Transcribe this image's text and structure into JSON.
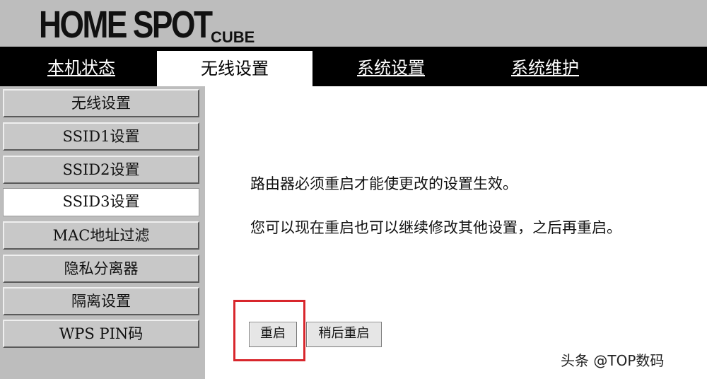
{
  "header": {
    "logo": "HOME SPOT",
    "logo_sub": "CUBE"
  },
  "nav": {
    "tabs": [
      {
        "label": "本机状态"
      },
      {
        "label": "无线设置"
      },
      {
        "label": "系统设置"
      },
      {
        "label": "系统维护"
      }
    ],
    "active_index": 1
  },
  "sidebar": {
    "items": [
      {
        "label": "无线设置"
      },
      {
        "label": "SSID1设置"
      },
      {
        "label": "SSID2设置"
      },
      {
        "label": "SSID3设置"
      },
      {
        "label": "MAC地址过滤"
      },
      {
        "label": "隐私分离器"
      },
      {
        "label": "隔离设置"
      },
      {
        "label": "WPS PIN码"
      }
    ],
    "active_index": 3
  },
  "main": {
    "message_1": "路由器必须重启才能使更改的设置生效。",
    "message_2": "您可以现在重启也可以继续修改其他设置，之后再重启。",
    "reboot_button": "重启",
    "reboot_later_button": "稍后重启"
  },
  "watermark": "头条 @TOP数码",
  "colors": {
    "highlight": "#d8262c",
    "nav_background": "#000000",
    "header_background": "#bdbdbd"
  }
}
